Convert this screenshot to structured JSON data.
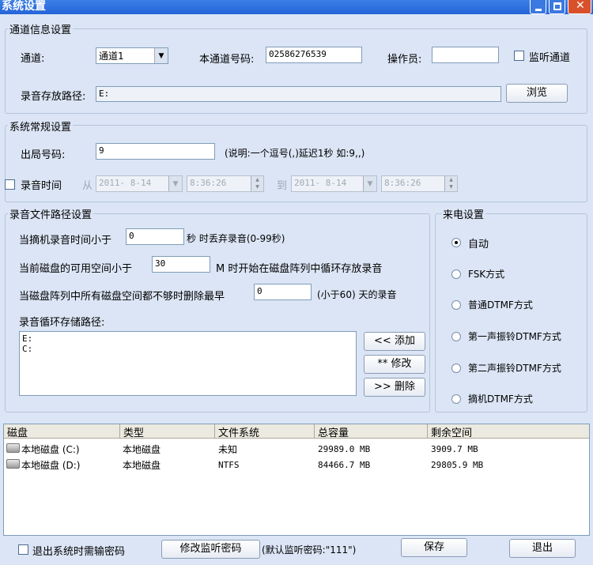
{
  "window": {
    "title": "系统设置"
  },
  "channel": {
    "section": "通道信息设置",
    "channel_label": "通道:",
    "channel_value": "通道1",
    "number_label": "本通道号码:",
    "number_value": "02586276539",
    "operator_label": "操作员:",
    "operator_value": "",
    "monitor_label": "监听通道",
    "path_label": "录音存放路径:",
    "path_value": "E:",
    "browse_label": "浏览"
  },
  "general": {
    "section": "系统常规设置",
    "outline_label": "出局号码:",
    "outline_value": "9",
    "outline_hint": "(说明:一个逗号(,)延迟1秒 如:9,,)",
    "rectime_label": "录音时间",
    "from_label": "从",
    "from_date": "2011- 8-14",
    "from_time": "8:36:26",
    "to_label": "到",
    "to_date": "2011- 8-14",
    "to_time": "8:36:26"
  },
  "recpath": {
    "section": "录音文件路径设置",
    "r1_pre": "当摘机录音时间小于",
    "r1_value": "0",
    "r1_post": "秒 时丢弃录音(0-99秒)",
    "r2_pre": "当前磁盘的可用空间小于",
    "r2_value": "30",
    "r2_post": "M 时开始在磁盘阵列中循环存放录音",
    "r3_pre": "当磁盘阵列中所有磁盘空间都不够时删除最早",
    "r3_value": "0",
    "r3_post": "(小于60) 天的录音",
    "loop_label": "录音循环存储路径:",
    "paths": [
      "E:",
      "C:"
    ],
    "add_label": "<< 添加",
    "edit_label": "** 修改",
    "delete_label": ">> 删除"
  },
  "callin": {
    "section": "来电设置",
    "options": [
      "自动",
      "FSK方式",
      "普通DTMF方式",
      "第一声振铃DTMF方式",
      "第二声振铃DTMF方式",
      "摘机DTMF方式"
    ],
    "selected": "自动"
  },
  "disks": {
    "headers": [
      "磁盘",
      "类型",
      "文件系统",
      "总容量",
      "剩余空间"
    ],
    "rows": [
      [
        "本地磁盘 (C:)",
        "本地磁盘",
        "未知",
        "29989.0 MB",
        "3909.7 MB"
      ],
      [
        "本地磁盘 (D:)",
        "本地磁盘",
        "NTFS",
        "84466.7 MB",
        "29805.9 MB"
      ]
    ]
  },
  "footer": {
    "exit_pw_label": "退出系统时需输密码",
    "change_pw_label": "修改监听密码",
    "default_pw_text": "(默认监听密码:\"111\")",
    "save_label": "保存",
    "exit_label": "退出"
  }
}
